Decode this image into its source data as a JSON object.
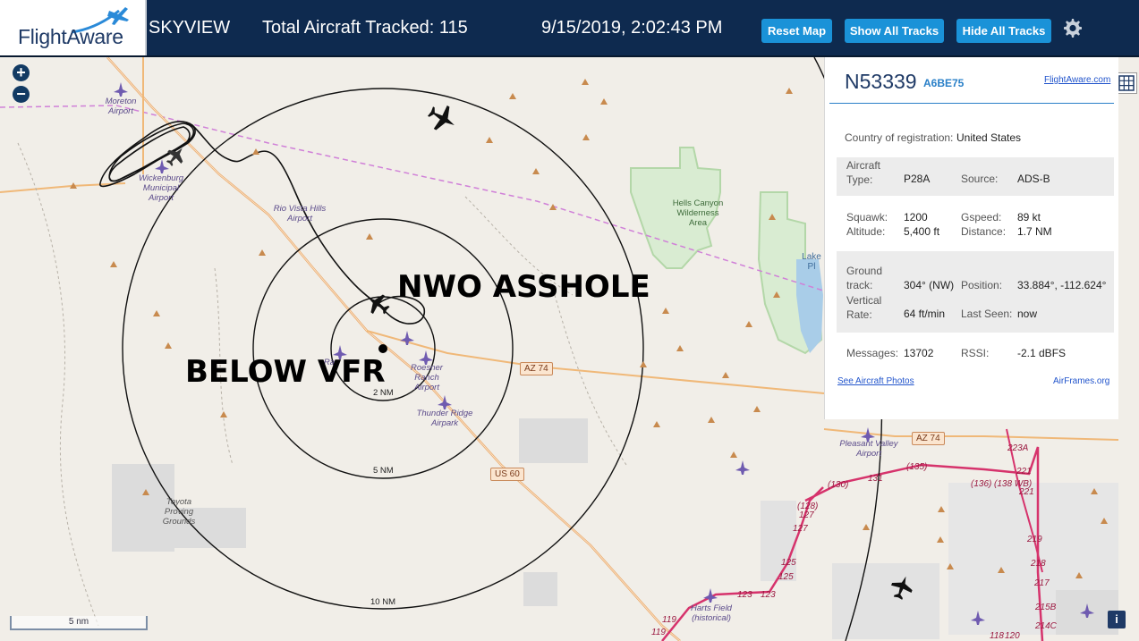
{
  "header": {
    "logo_text": "FlightAware",
    "app_name": "SKYVIEW",
    "total_tracked": "Total Aircraft Tracked: 115",
    "datetime": "9/15/2019, 2:02:43 PM",
    "buttons": {
      "reset": "Reset Map",
      "show_all": "Show All Tracks",
      "hide_all": "Hide All Tracks"
    },
    "settings_icon": "gear-icon"
  },
  "map": {
    "zoom_in": "+",
    "zoom_out": "−",
    "overlay_text": {
      "top": "NWO ASSHOLE",
      "bottom": "BELOW VFR"
    },
    "range_rings": [
      "2 NM",
      "5 NM",
      "10 NM"
    ],
    "scale_label": "5 nm",
    "info_button": "i",
    "places": {
      "moreton": "Moreton Airport",
      "wickenburg": "Wickenburg Municipal Airport",
      "rio_vista": "Rio Vista Hills Airport",
      "hells_canyon": "Hells Canyon Wilderness Area",
      "roesner": "Roesner Ranch Airport",
      "thunder_ridge": "Thunder Ridge Airpark",
      "toyota": "Toyota Proving Grounds",
      "pleasant_valley": "Pleasant Valley Airport",
      "harts_field": "Harts Field (historical)",
      "lake": "Lake Pl",
      "ranch_stub": "Ra"
    },
    "road_shields": {
      "az74_a": "AZ 74",
      "az74_b": "AZ 74",
      "us60": "US 60"
    },
    "road_numbers": [
      "(135)",
      "(130)",
      "131",
      "(136)",
      "(138 WB)",
      "221",
      "223A",
      "221",
      "(128)",
      "127",
      "127",
      "125",
      "125",
      "123",
      "123",
      "219",
      "218",
      "217",
      "215B",
      "214C",
      "119",
      "119",
      "120",
      "118"
    ]
  },
  "panel": {
    "registration": "N53339",
    "hex": "A6BE75",
    "flightaware_link": "FlightAware.com",
    "country_label": "Country of registration:",
    "country": "United States",
    "aircraft_type_label": "Aircraft Type:",
    "aircraft_type": "P28A",
    "source_label": "Source:",
    "source": "ADS-B",
    "squawk_label": "Squawk:",
    "squawk": "1200",
    "gspeed_label": "Gspeed:",
    "gspeed": "89 kt",
    "altitude_label": "Altitude:",
    "altitude": "5,400 ft",
    "distance_label": "Distance:",
    "distance": "1.7 NM",
    "ground_track_label": "Ground track:",
    "ground_track": "304° (NW)",
    "position_label": "Position:",
    "position": "33.884°, -112.624°",
    "vertical_rate_label": "Vertical Rate:",
    "vertical_rate": "64 ft/min",
    "last_seen_label": "Last Seen:",
    "last_seen": "now",
    "messages_label": "Messages:",
    "messages": "13702",
    "rssi_label": "RSSI:",
    "rssi": "-2.1 dBFS",
    "photos_link": "See Aircraft Photos",
    "airframes_link": "AirFrames.org"
  },
  "colors": {
    "header_bg": "#0e2a4f",
    "button_bg": "#1a92d8",
    "map_bg": "#f1eee8",
    "accent_blue": "#2a80c8",
    "track": "#000000",
    "road_orange": "#e8a96a",
    "road_pink": "#d6336c"
  }
}
